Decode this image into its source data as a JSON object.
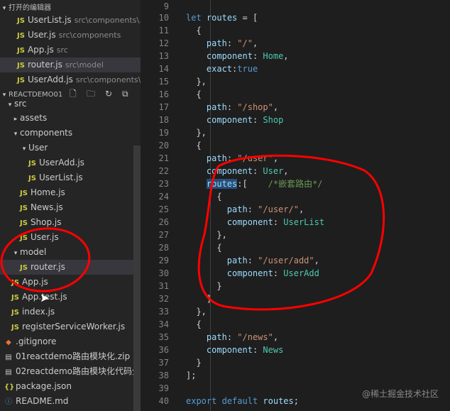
{
  "sidebar": {
    "open_editors_header": "打开的编辑器",
    "open_editors": [
      {
        "name": "UserList.js",
        "path": "src\\components\\..."
      },
      {
        "name": "User.js",
        "path": "src\\components"
      },
      {
        "name": "App.js",
        "path": "src"
      },
      {
        "name": "router.js",
        "path": "src\\model"
      },
      {
        "name": "UserAdd.js",
        "path": "src\\components\\..."
      }
    ],
    "project_header": "REACTDEMO01",
    "tree": [
      {
        "label": "src",
        "kind": "folder-open"
      },
      {
        "label": "assets",
        "kind": "folder"
      },
      {
        "label": "components",
        "kind": "folder-open"
      },
      {
        "label": "User",
        "kind": "folder-open"
      },
      {
        "label": "UserAdd.js",
        "kind": "js"
      },
      {
        "label": "UserList.js",
        "kind": "js"
      },
      {
        "label": "Home.js",
        "kind": "js"
      },
      {
        "label": "News.js",
        "kind": "js"
      },
      {
        "label": "Shop.js",
        "kind": "js"
      },
      {
        "label": "User.js",
        "kind": "js"
      },
      {
        "label": "model",
        "kind": "folder-open"
      },
      {
        "label": "router.js",
        "kind": "js"
      },
      {
        "label": "App.js",
        "kind": "js"
      },
      {
        "label": "App.test.js",
        "kind": "js"
      },
      {
        "label": "index.js",
        "kind": "js"
      },
      {
        "label": "registerServiceWorker.js",
        "kind": "js"
      },
      {
        "label": ".gitignore",
        "kind": "git"
      },
      {
        "label": "01reactdemo路由模块化.zip",
        "kind": "zip"
      },
      {
        "label": "02reactdemo路由模块化代码分...",
        "kind": "zip"
      },
      {
        "label": "package.json",
        "kind": "json"
      },
      {
        "label": "README.md",
        "kind": "md"
      }
    ],
    "js_badge": "JS",
    "colors": {
      "background": "#252526",
      "js_badge": "#cbcb41",
      "active_row": "#37373d"
    }
  },
  "editor": {
    "line_numbers": [
      "9",
      "10",
      "11",
      "12",
      "13",
      "14",
      "15",
      "16",
      "17",
      "18",
      "19",
      "20",
      "21",
      "22",
      "23",
      "24",
      "25",
      "26",
      "27",
      "28",
      "29",
      "30",
      "31",
      "32",
      "33",
      "34",
      "35",
      "36",
      "37",
      "38",
      "39",
      "40"
    ],
    "lines": [
      "",
      "let routes = [",
      "  {",
      "    path: \"/\",",
      "    component: Home,",
      "    exact:true",
      "  },",
      "  {",
      "    path: \"/shop\",",
      "    component: Shop",
      "  },",
      "  {",
      "    path: \"/user\",",
      "    component: User,",
      "    routes:[    /*嵌套路由*/",
      "      {",
      "        path: \"/user/\",",
      "        component: UserList",
      "      },",
      "      {",
      "        path: \"/user/add\",",
      "        component: UserAdd",
      "      }",
      "    ]",
      "  },",
      "  {",
      "    path: \"/news\",",
      "    component: News",
      "  }",
      "];",
      "",
      "export default routes;"
    ],
    "colors": {
      "background": "#1e1e1e",
      "keyword": "#569cd6",
      "string": "#ce9178",
      "property": "#9cdcfe",
      "value": "#4ec9b0",
      "comment": "#6a9955",
      "annotation": "#ff0000"
    }
  },
  "watermark": "@稀土掘金技术社区"
}
